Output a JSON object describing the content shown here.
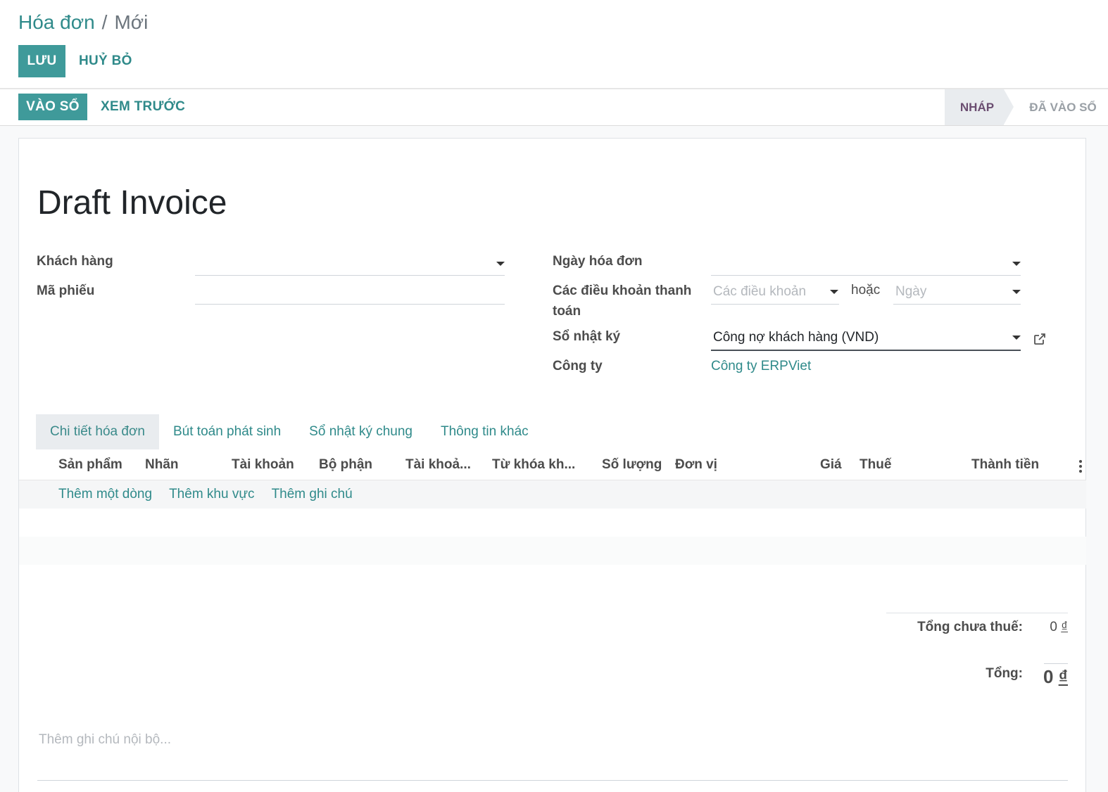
{
  "breadcrumb": {
    "parent": "Hóa đơn",
    "separator": "/",
    "current": "Mới"
  },
  "control": {
    "save_label": "LƯU",
    "discard_label": "HUỶ BỎ"
  },
  "actions": {
    "post_label": "VÀO SỔ",
    "preview_label": "XEM TRƯỚC"
  },
  "statusbar": {
    "stages": [
      "NHÁP",
      "ĐÃ VÀO SỔ"
    ],
    "active_stage": "NHÁP"
  },
  "form": {
    "title": "Draft Invoice",
    "left": {
      "customer_label": "Khách hàng",
      "customer_value": "",
      "reference_label": "Mã phiếu",
      "reference_value": ""
    },
    "right": {
      "invoice_date_label": "Ngày hóa đơn",
      "invoice_date_value": "",
      "payment_terms_label_line1": "Các điều khoản thanh",
      "payment_terms_label_line2": "toán",
      "payment_terms_placeholder": "Các điều khoản",
      "or_label": "hoặc",
      "due_date_placeholder": "Ngày",
      "journal_label": "Sổ nhật ký",
      "journal_value": "Công nợ khách hàng (VND)",
      "company_label": "Công ty",
      "company_value": "Công ty ERPViet"
    }
  },
  "tabs": [
    {
      "label": "Chi tiết hóa đơn",
      "active": true
    },
    {
      "label": "Bút toán phát sinh",
      "active": false
    },
    {
      "label": "Sổ nhật ký chung",
      "active": false
    },
    {
      "label": "Thông tin khác",
      "active": false
    }
  ],
  "lines_table": {
    "columns": [
      "Sản phẩm",
      "Nhãn",
      "Tài khoản",
      "Bộ phận",
      "Tài khoả...",
      "Từ khóa kh...",
      "Số lượng",
      "Đơn vị",
      "Giá",
      "Thuế",
      "Thành tiền"
    ],
    "add_line": "Thêm một dòng",
    "add_section": "Thêm khu vực",
    "add_note": "Thêm ghi chú"
  },
  "totals": {
    "untaxed_label": "Tổng chưa thuế:",
    "untaxed_amount": "0",
    "total_label": "Tổng:",
    "total_amount": "0",
    "currency_symbol": "₫"
  },
  "narration_placeholder": "Thêm ghi chú nội bộ...",
  "colors": {
    "primary": "#3f9a9a",
    "link": "#2f8a8a",
    "status_active": "#6b4e71"
  }
}
